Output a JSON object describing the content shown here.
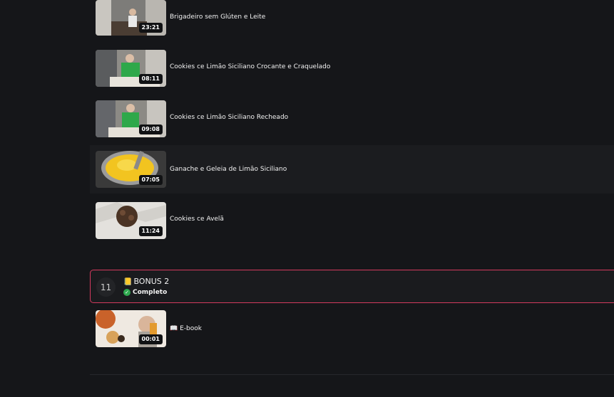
{
  "lessons": [
    {
      "title": "Brigadeiro sem Glúten e Leite",
      "duration": "23:21",
      "thumb_icon": "kitchen-video-thumbnail"
    },
    {
      "title": "Cookies ce Limão Siciliano Crocante e Craquelado",
      "duration": "08:11",
      "thumb_icon": "kitchen-video-thumbnail"
    },
    {
      "title": "Cookies ce Limão Siciliano Recheado",
      "duration": "09:08",
      "thumb_icon": "kitchen-video-thumbnail"
    },
    {
      "title": "Ganache e Geleia de Limão Siciliano",
      "duration": "07:05",
      "thumb_icon": "saucepan-video-thumbnail"
    },
    {
      "title": "Cookies ce Avelã",
      "duration": "11:24",
      "thumb_icon": "cookie-video-thumbnail"
    }
  ],
  "module": {
    "number": "11",
    "icon": "📒",
    "title": "BONUS 2",
    "status": "Completo",
    "status_icon": "check-circle-icon",
    "border_color": "#d43a5e",
    "status_color": "#2fa84f"
  },
  "module_lessons": [
    {
      "icon": "📖",
      "title": "E-book",
      "duration": "00:01",
      "thumb_icon": "ebook-video-thumbnail"
    }
  ]
}
